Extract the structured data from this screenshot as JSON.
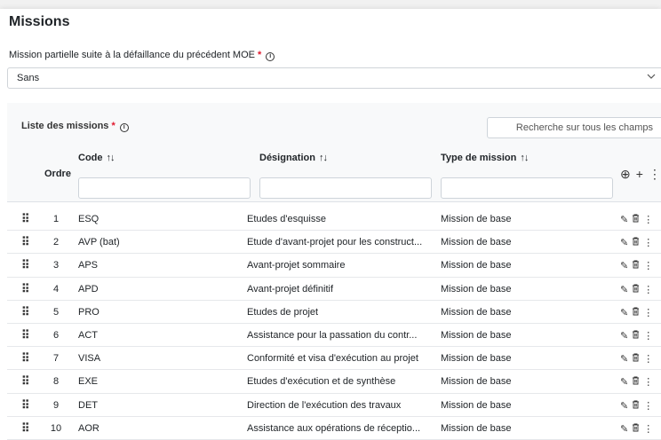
{
  "page": {
    "title": "Missions"
  },
  "mission_partielle": {
    "label": "Mission partielle suite à la défaillance du précédent MOE",
    "required_mark": "*",
    "value": "Sans"
  },
  "list": {
    "label": "Liste des missions",
    "required_mark": "*",
    "search_placeholder": "Recherche sur tous les champs"
  },
  "table": {
    "headers": {
      "ordre": "Ordre",
      "code": "Code",
      "designation": "Désignation",
      "type": "Type de mission",
      "sort_glyph": "↑↓"
    },
    "rows": [
      {
        "ordre": "1",
        "code": "ESQ",
        "designation": "Etudes d'esquisse",
        "type": "Mission de base"
      },
      {
        "ordre": "2",
        "code": "AVP (bat)",
        "designation": "Etude d'avant-projet pour les construct...",
        "type": "Mission de base"
      },
      {
        "ordre": "3",
        "code": "APS",
        "designation": "Avant-projet sommaire",
        "type": "Mission de base"
      },
      {
        "ordre": "4",
        "code": "APD",
        "designation": "Avant-projet définitif",
        "type": "Mission de base"
      },
      {
        "ordre": "5",
        "code": "PRO",
        "designation": "Etudes de projet",
        "type": "Mission de base"
      },
      {
        "ordre": "6",
        "code": "ACT",
        "designation": "Assistance pour la passation du contr...",
        "type": "Mission de base"
      },
      {
        "ordre": "7",
        "code": "VISA",
        "designation": "Conformité et visa d'exécution au projet",
        "type": "Mission de base"
      },
      {
        "ordre": "8",
        "code": "EXE",
        "designation": "Etudes d'exécution et de synthèse",
        "type": "Mission de base"
      },
      {
        "ordre": "9",
        "code": "DET",
        "designation": "Direction de l'exécution des travaux",
        "type": "Mission de base"
      },
      {
        "ordre": "10",
        "code": "AOR",
        "designation": "Assistance aux opérations de réceptio...",
        "type": "Mission de base"
      }
    ]
  },
  "icons": {
    "info": "ⓘ",
    "chevron": "∨",
    "zoom": "⊕",
    "add": "+",
    "more": "⋮",
    "drag": "⠿",
    "edit": "✎",
    "delete": "🗑"
  }
}
